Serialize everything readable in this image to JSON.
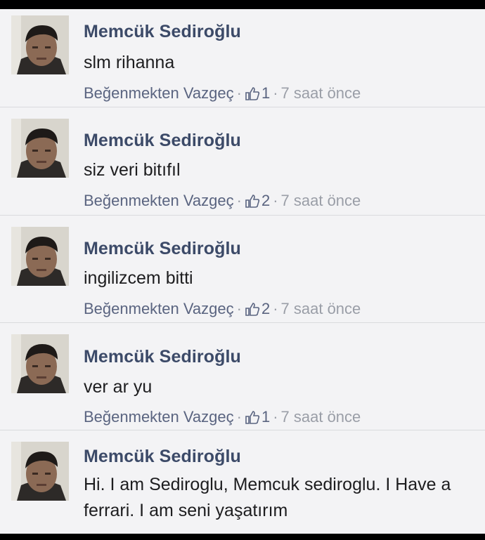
{
  "comments": [
    {
      "author": "Memcük Sediroğlu",
      "message": "slm rihanna",
      "unlike_label": "Beğenmekten Vazgeç",
      "like_count": "1",
      "time": "7 saat önce",
      "separator": "·"
    },
    {
      "author": "Memcük Sediroğlu",
      "message": "siz veri bitıfıl",
      "unlike_label": "Beğenmekten Vazgeç",
      "like_count": "2",
      "time": "7 saat önce",
      "separator": "·"
    },
    {
      "author": "Memcük Sediroğlu",
      "message": "ingilizcem bitti",
      "unlike_label": "Beğenmekten Vazgeç",
      "like_count": "2",
      "time": "7 saat önce",
      "separator": "·"
    },
    {
      "author": "Memcük Sediroğlu",
      "message": "ver ar yu",
      "unlike_label": "Beğenmekten Vazgeç",
      "like_count": "1",
      "time": "7 saat önce",
      "separator": "·"
    },
    {
      "author": "Memcük Sediroğlu",
      "message": "Hi. I am Sediroglu, Memcuk sediroglu. I Have a ferrari. I am seni yaşatırım"
    }
  ],
  "colors": {
    "author": "#3c4a68",
    "background": "#f3f3f5",
    "meta": "#8d919a",
    "divider": "#d9dadd"
  },
  "icons": {
    "avatar": "profile-photo",
    "like": "thumbs-up-icon"
  }
}
